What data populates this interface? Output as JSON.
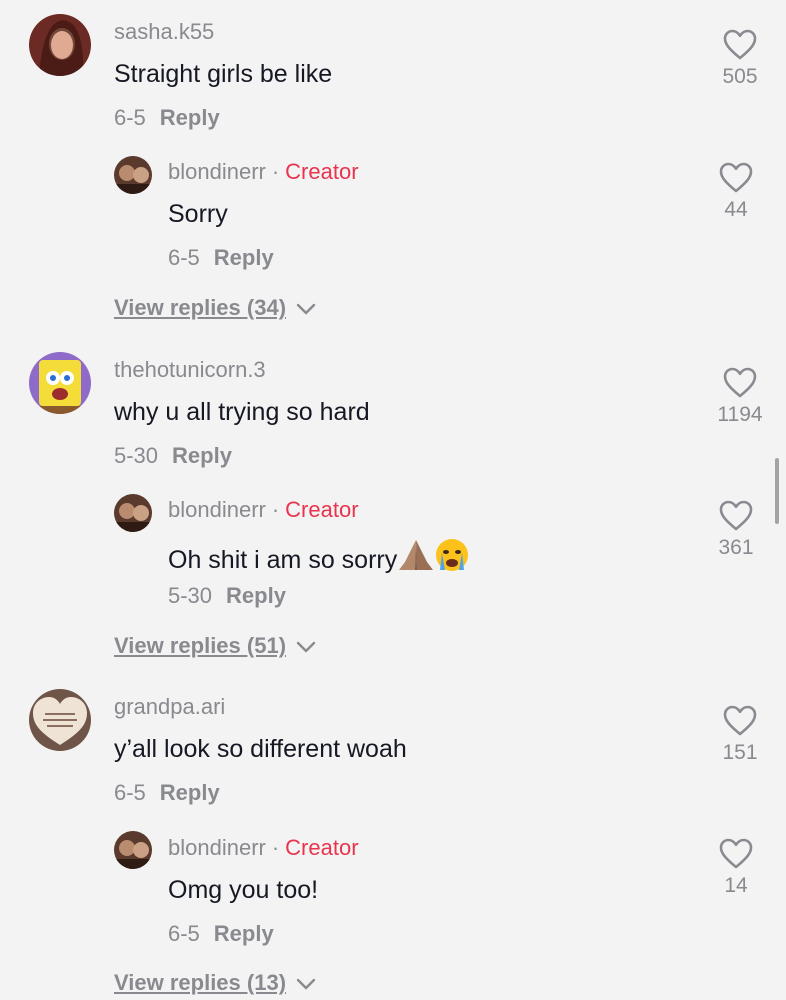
{
  "comments": [
    {
      "username": "sasha.k55",
      "text": "Straight girls be like",
      "date": "6-5",
      "reply_label": "Reply",
      "likes": "505",
      "reply": {
        "username": "blondinerr",
        "sep": "·",
        "badge": "Creator",
        "text": "Sorry",
        "date": "6-5",
        "reply_label": "Reply",
        "likes": "44"
      },
      "view_replies": "View replies (34)"
    },
    {
      "username": "thehotunicorn.3",
      "text": "why u all trying so hard",
      "date": "5-30",
      "reply_label": "Reply",
      "likes": "1194",
      "reply": {
        "username": "blondinerr",
        "sep": "·",
        "badge": "Creator",
        "text": "Oh shit i am so sorry",
        "date": "5-30",
        "reply_label": "Reply",
        "likes": "361"
      },
      "view_replies": "View replies (51)"
    },
    {
      "username": "grandpa.ari",
      "text": "y’all look so different woah",
      "date": "6-5",
      "reply_label": "Reply",
      "likes": "151",
      "reply": {
        "username": "blondinerr",
        "sep": "·",
        "badge": "Creator",
        "text": "Omg you too!",
        "date": "6-5",
        "reply_label": "Reply",
        "likes": "14"
      },
      "view_replies": "View replies (13)"
    }
  ],
  "colors": {
    "background": "#f3f3f3",
    "creator_badge": "#e8354f",
    "secondary_text": "#888a8f"
  },
  "icons": [
    "heart-outline-icon",
    "chevron-down-icon",
    "praying-hands-emoji",
    "crying-face-emoji"
  ]
}
